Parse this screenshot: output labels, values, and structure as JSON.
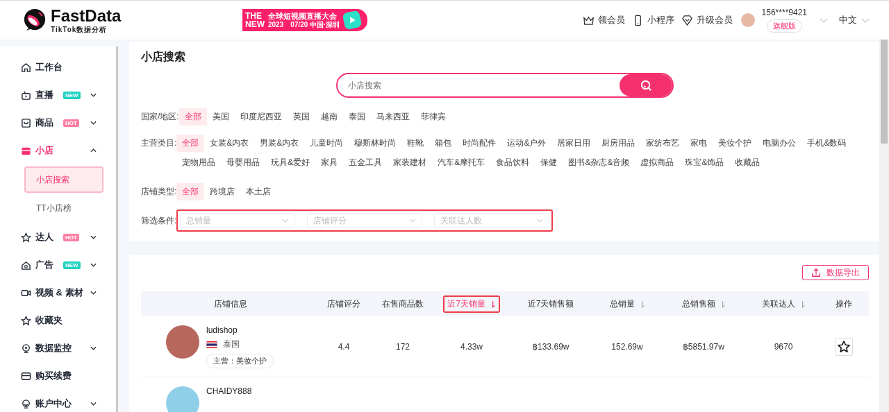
{
  "header": {
    "logo_title": "FastData",
    "logo_subtitle": "TikTok数据分析",
    "banner": {
      "tag_line1": "THE",
      "tag_line2": "NEW",
      "title": "全球短视频直播大会",
      "year": "2023",
      "date_place": "07/20 中国·深圳"
    },
    "links": [
      "领会员",
      "小程序",
      "升级会员"
    ],
    "user": {
      "phone": "156****9421",
      "plan": "旗舰版"
    },
    "language": "中文"
  },
  "sidebar": {
    "items": [
      {
        "label": "工作台",
        "selected": false
      },
      {
        "label": "直播",
        "badge": "NEW",
        "color": "#1fd1c0",
        "expanded": false,
        "selected": false
      },
      {
        "label": "商品",
        "badge": "HOT",
        "color": "#fb7fa3",
        "expanded": false,
        "selected": false
      },
      {
        "label": "小店",
        "expanded": true,
        "selected": true,
        "children": [
          {
            "label": "小店搜索",
            "selected": true
          },
          {
            "label": "TT小店榜",
            "selected": false
          }
        ]
      },
      {
        "label": "达人",
        "badge": "HOT",
        "color": "#fb7fa3",
        "expanded": false,
        "selected": false
      },
      {
        "label": "广告",
        "badge": "NEW",
        "color": "#1fd1c0",
        "expanded": false,
        "selected": false
      },
      {
        "label": "视频 & 素材",
        "expanded": false,
        "selected": false
      },
      {
        "label": "收藏夹",
        "selected": false
      },
      {
        "label": "数据监控",
        "expanded": false,
        "selected": false
      },
      {
        "label": "购买续费",
        "selected": false
      },
      {
        "label": "账户中心",
        "expanded": false,
        "selected": false
      }
    ]
  },
  "search_panel": {
    "title": "小店搜索",
    "search": {
      "placeholder": "小店搜索"
    },
    "filters": [
      {
        "label": "国家/地区:",
        "options": [
          {
            "label": "全部",
            "selected": true
          },
          {
            "label": "美国",
            "selected": false
          },
          {
            "label": "印度尼西亚",
            "selected": false
          },
          {
            "label": "英国",
            "selected": false
          },
          {
            "label": "越南",
            "selected": false
          },
          {
            "label": "泰国",
            "selected": false
          },
          {
            "label": "马来西亚",
            "selected": false
          },
          {
            "label": "菲律宾",
            "selected": false
          }
        ]
      },
      {
        "label": "主营类目:",
        "options": [
          {
            "label": "全部",
            "selected": true
          },
          {
            "label": "女装&内衣",
            "selected": false
          },
          {
            "label": "男装&内衣",
            "selected": false
          },
          {
            "label": "儿童时尚",
            "selected": false
          },
          {
            "label": "穆斯林时尚",
            "selected": false
          },
          {
            "label": "鞋靴",
            "selected": false
          },
          {
            "label": "箱包",
            "selected": false
          },
          {
            "label": "时尚配件",
            "selected": false
          },
          {
            "label": "运动&户外",
            "selected": false
          },
          {
            "label": "居家日用",
            "selected": false
          },
          {
            "label": "厨房用品",
            "selected": false
          },
          {
            "label": "家纺布艺",
            "selected": false
          },
          {
            "label": "家电",
            "selected": false
          },
          {
            "label": "美妆个护",
            "selected": false
          },
          {
            "label": "电脑办公",
            "selected": false
          },
          {
            "label": "手机&数码",
            "selected": false
          },
          {
            "label": "宠物用品",
            "selected": false
          },
          {
            "label": "母婴用品",
            "selected": false
          },
          {
            "label": "玩具&爱好",
            "selected": false
          },
          {
            "label": "家具",
            "selected": false
          },
          {
            "label": "五金工具",
            "selected": false
          },
          {
            "label": "家装建材",
            "selected": false
          },
          {
            "label": "汽车&摩托车",
            "selected": false
          },
          {
            "label": "食品饮料",
            "selected": false
          },
          {
            "label": "保健",
            "selected": false
          },
          {
            "label": "图书&杂志&音频",
            "selected": false
          },
          {
            "label": "虚拟商品",
            "selected": false
          },
          {
            "label": "珠宝&饰品",
            "selected": false
          },
          {
            "label": "收藏品",
            "selected": false
          }
        ]
      },
      {
        "label": "店铺类型:",
        "options": [
          {
            "label": "全部",
            "selected": true
          },
          {
            "label": "跨境店",
            "selected": false
          },
          {
            "label": "本土店",
            "selected": false
          }
        ]
      }
    ],
    "conditions": {
      "label": "筛选条件:",
      "highlighted": true,
      "selects": [
        {
          "placeholder": "总销量"
        },
        {
          "placeholder": "店铺评分"
        },
        {
          "placeholder": "关联达人数"
        }
      ]
    }
  },
  "table": {
    "export_button": "数据导出",
    "columns": [
      {
        "label": "店铺信息",
        "sortable": false,
        "selected": false
      },
      {
        "label": "店铺评分",
        "sortable": false,
        "selected": false
      },
      {
        "label": "在售商品数",
        "sortable": false,
        "selected": false
      },
      {
        "label": "近7天销量",
        "sortable": true,
        "selected": true
      },
      {
        "label": "近7天销售额",
        "sortable": false,
        "selected": false
      },
      {
        "label": "总销量",
        "sortable": true,
        "selected": false
      },
      {
        "label": "总销售额",
        "sortable": true,
        "selected": false
      },
      {
        "label": "关联达人",
        "sortable": true,
        "selected": false
      },
      {
        "label": "操作",
        "sortable": false,
        "selected": false
      }
    ],
    "rows": [
      {
        "name": "ludishop",
        "country": "泰国",
        "category": "主营：美妆个护",
        "values": [
          "4.4",
          "172",
          "4.33w",
          "฿133.69w",
          "152.69w",
          "฿5851.97w",
          "9670"
        ],
        "favorited": false
      },
      {
        "name": "CHAIDY888"
      }
    ]
  }
}
